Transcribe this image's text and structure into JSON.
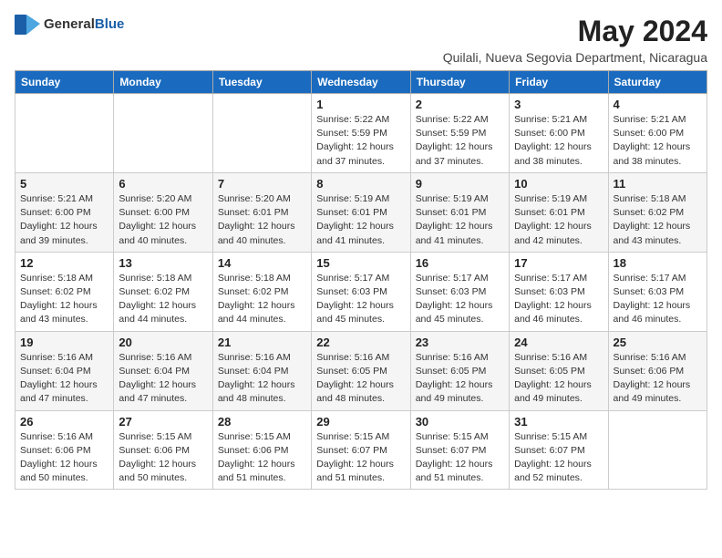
{
  "logo": {
    "general": "General",
    "blue": "Blue"
  },
  "title": {
    "month_year": "May 2024",
    "location": "Quilali, Nueva Segovia Department, Nicaragua"
  },
  "header_days": [
    "Sunday",
    "Monday",
    "Tuesday",
    "Wednesday",
    "Thursday",
    "Friday",
    "Saturday"
  ],
  "weeks": [
    [
      {
        "day": "",
        "info": ""
      },
      {
        "day": "",
        "info": ""
      },
      {
        "day": "",
        "info": ""
      },
      {
        "day": "1",
        "info": "Sunrise: 5:22 AM\nSunset: 5:59 PM\nDaylight: 12 hours\nand 37 minutes."
      },
      {
        "day": "2",
        "info": "Sunrise: 5:22 AM\nSunset: 5:59 PM\nDaylight: 12 hours\nand 37 minutes."
      },
      {
        "day": "3",
        "info": "Sunrise: 5:21 AM\nSunset: 6:00 PM\nDaylight: 12 hours\nand 38 minutes."
      },
      {
        "day": "4",
        "info": "Sunrise: 5:21 AM\nSunset: 6:00 PM\nDaylight: 12 hours\nand 38 minutes."
      }
    ],
    [
      {
        "day": "5",
        "info": "Sunrise: 5:21 AM\nSunset: 6:00 PM\nDaylight: 12 hours\nand 39 minutes."
      },
      {
        "day": "6",
        "info": "Sunrise: 5:20 AM\nSunset: 6:00 PM\nDaylight: 12 hours\nand 40 minutes."
      },
      {
        "day": "7",
        "info": "Sunrise: 5:20 AM\nSunset: 6:01 PM\nDaylight: 12 hours\nand 40 minutes."
      },
      {
        "day": "8",
        "info": "Sunrise: 5:19 AM\nSunset: 6:01 PM\nDaylight: 12 hours\nand 41 minutes."
      },
      {
        "day": "9",
        "info": "Sunrise: 5:19 AM\nSunset: 6:01 PM\nDaylight: 12 hours\nand 41 minutes."
      },
      {
        "day": "10",
        "info": "Sunrise: 5:19 AM\nSunset: 6:01 PM\nDaylight: 12 hours\nand 42 minutes."
      },
      {
        "day": "11",
        "info": "Sunrise: 5:18 AM\nSunset: 6:02 PM\nDaylight: 12 hours\nand 43 minutes."
      }
    ],
    [
      {
        "day": "12",
        "info": "Sunrise: 5:18 AM\nSunset: 6:02 PM\nDaylight: 12 hours\nand 43 minutes."
      },
      {
        "day": "13",
        "info": "Sunrise: 5:18 AM\nSunset: 6:02 PM\nDaylight: 12 hours\nand 44 minutes."
      },
      {
        "day": "14",
        "info": "Sunrise: 5:18 AM\nSunset: 6:02 PM\nDaylight: 12 hours\nand 44 minutes."
      },
      {
        "day": "15",
        "info": "Sunrise: 5:17 AM\nSunset: 6:03 PM\nDaylight: 12 hours\nand 45 minutes."
      },
      {
        "day": "16",
        "info": "Sunrise: 5:17 AM\nSunset: 6:03 PM\nDaylight: 12 hours\nand 45 minutes."
      },
      {
        "day": "17",
        "info": "Sunrise: 5:17 AM\nSunset: 6:03 PM\nDaylight: 12 hours\nand 46 minutes."
      },
      {
        "day": "18",
        "info": "Sunrise: 5:17 AM\nSunset: 6:03 PM\nDaylight: 12 hours\nand 46 minutes."
      }
    ],
    [
      {
        "day": "19",
        "info": "Sunrise: 5:16 AM\nSunset: 6:04 PM\nDaylight: 12 hours\nand 47 minutes."
      },
      {
        "day": "20",
        "info": "Sunrise: 5:16 AM\nSunset: 6:04 PM\nDaylight: 12 hours\nand 47 minutes."
      },
      {
        "day": "21",
        "info": "Sunrise: 5:16 AM\nSunset: 6:04 PM\nDaylight: 12 hours\nand 48 minutes."
      },
      {
        "day": "22",
        "info": "Sunrise: 5:16 AM\nSunset: 6:05 PM\nDaylight: 12 hours\nand 48 minutes."
      },
      {
        "day": "23",
        "info": "Sunrise: 5:16 AM\nSunset: 6:05 PM\nDaylight: 12 hours\nand 49 minutes."
      },
      {
        "day": "24",
        "info": "Sunrise: 5:16 AM\nSunset: 6:05 PM\nDaylight: 12 hours\nand 49 minutes."
      },
      {
        "day": "25",
        "info": "Sunrise: 5:16 AM\nSunset: 6:06 PM\nDaylight: 12 hours\nand 49 minutes."
      }
    ],
    [
      {
        "day": "26",
        "info": "Sunrise: 5:16 AM\nSunset: 6:06 PM\nDaylight: 12 hours\nand 50 minutes."
      },
      {
        "day": "27",
        "info": "Sunrise: 5:15 AM\nSunset: 6:06 PM\nDaylight: 12 hours\nand 50 minutes."
      },
      {
        "day": "28",
        "info": "Sunrise: 5:15 AM\nSunset: 6:06 PM\nDaylight: 12 hours\nand 51 minutes."
      },
      {
        "day": "29",
        "info": "Sunrise: 5:15 AM\nSunset: 6:07 PM\nDaylight: 12 hours\nand 51 minutes."
      },
      {
        "day": "30",
        "info": "Sunrise: 5:15 AM\nSunset: 6:07 PM\nDaylight: 12 hours\nand 51 minutes."
      },
      {
        "day": "31",
        "info": "Sunrise: 5:15 AM\nSunset: 6:07 PM\nDaylight: 12 hours\nand 52 minutes."
      },
      {
        "day": "",
        "info": ""
      }
    ]
  ]
}
